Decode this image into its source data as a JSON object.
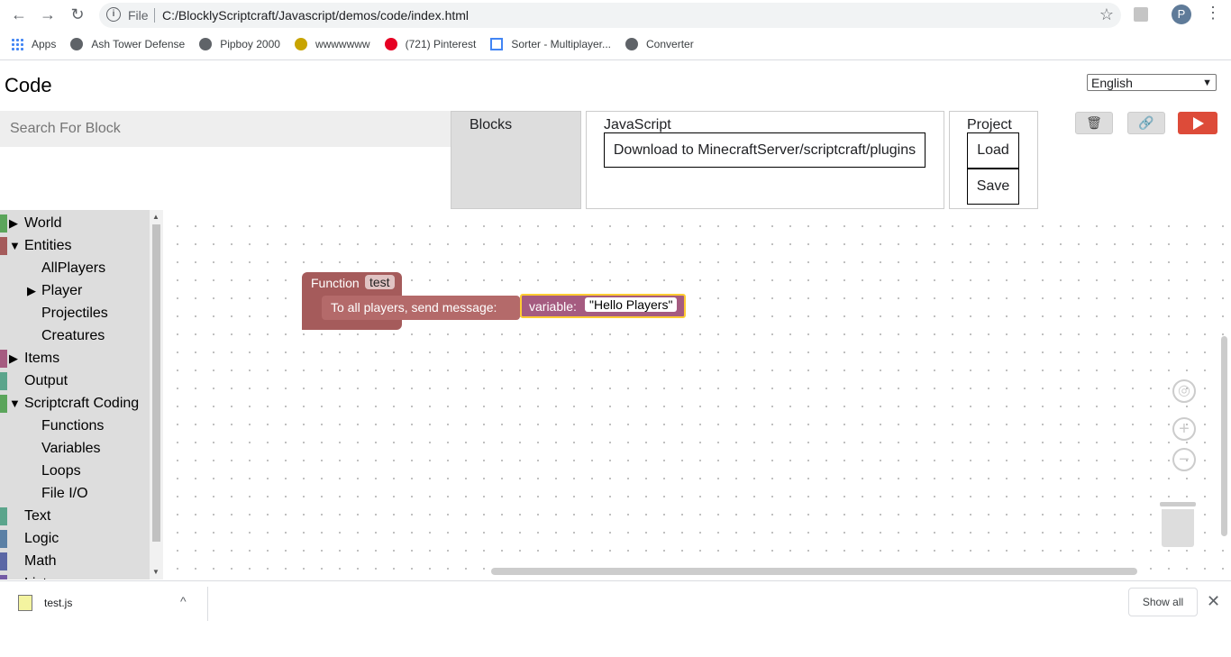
{
  "browser": {
    "back_glyph": "←",
    "forward_glyph": "→",
    "reload_glyph": "↻",
    "url_scheme": "File",
    "url": "C:/BlocklyScriptcraft/Javascript/demos/code/index.html",
    "star_glyph": "☆",
    "avatar_letter": "P",
    "menu_glyph": "⋮",
    "info_glyph": "i",
    "bookmarks": [
      {
        "label": "Apps",
        "icon": "apps-grid-icon"
      },
      {
        "label": "Ash Tower Defense",
        "icon": "globe-icon"
      },
      {
        "label": "Pipboy 2000",
        "icon": "globe-icon"
      },
      {
        "label": "wwwwwww",
        "icon": "skull-icon"
      },
      {
        "label": "(721) Pinterest",
        "icon": "pinterest-icon"
      },
      {
        "label": "Sorter - Multiplayer...",
        "icon": "sorter-icon"
      },
      {
        "label": "Converter",
        "icon": "globe-icon"
      }
    ]
  },
  "page": {
    "title": "Code",
    "language": "English",
    "search_placeholder": "Search For Block",
    "tabs": {
      "blocks": "Blocks",
      "javascript": "JavaScript",
      "download_label": "Download to MinecraftServer/scriptcraft/plugins",
      "project": "Project",
      "load": "Load",
      "save": "Save"
    },
    "toolbar": {
      "trash_glyph": "🗑",
      "link_glyph": "🔗"
    }
  },
  "toolbox": {
    "categories": [
      {
        "label": "World",
        "expander": "▶",
        "color": "#5ba55b",
        "indent": 0
      },
      {
        "label": "Entities",
        "expander": "▼",
        "color": "#a55b5b",
        "indent": 0
      },
      {
        "label": "AllPlayers",
        "expander": "",
        "color": "",
        "indent": 1
      },
      {
        "label": "Player",
        "expander": "▶",
        "color": "",
        "indent": 1
      },
      {
        "label": "Projectiles",
        "expander": "",
        "color": "",
        "indent": 1
      },
      {
        "label": "Creatures",
        "expander": "",
        "color": "",
        "indent": 1
      },
      {
        "label": "Items",
        "expander": "▶",
        "color": "#a55b80",
        "indent": 0
      },
      {
        "label": "Output",
        "expander": "",
        "color": "#5ba58c",
        "indent": 0
      },
      {
        "label": "Scriptcraft Coding",
        "expander": "▼",
        "color": "#5ba55b",
        "indent": 0
      },
      {
        "label": "Functions",
        "expander": "",
        "color": "",
        "indent": 1
      },
      {
        "label": "Variables",
        "expander": "",
        "color": "",
        "indent": 1
      },
      {
        "label": "Loops",
        "expander": "",
        "color": "",
        "indent": 1
      },
      {
        "label": "File I/O",
        "expander": "",
        "color": "",
        "indent": 1
      },
      {
        "label": "Text",
        "expander": "",
        "color": "#5ba58c",
        "indent": 0
      },
      {
        "label": "Logic",
        "expander": "",
        "color": "#5b80a5",
        "indent": 0
      },
      {
        "label": "Math",
        "expander": "",
        "color": "#5b67a5",
        "indent": 0
      },
      {
        "label": "Lists",
        "expander": "",
        "color": "#745ba5",
        "indent": 0
      }
    ]
  },
  "workspace": {
    "function_label": "Function",
    "function_name": "test",
    "message_label": "To all players, send message:",
    "variable_label": "variable:",
    "variable_value": "\"Hello Players\"",
    "zoom_in_glyph": "+",
    "zoom_out_glyph": "−",
    "recenter_glyph": "◎"
  },
  "downloads": {
    "file_name": "test.js",
    "chevron": "^",
    "show_all": "Show all",
    "close_glyph": "✕"
  }
}
